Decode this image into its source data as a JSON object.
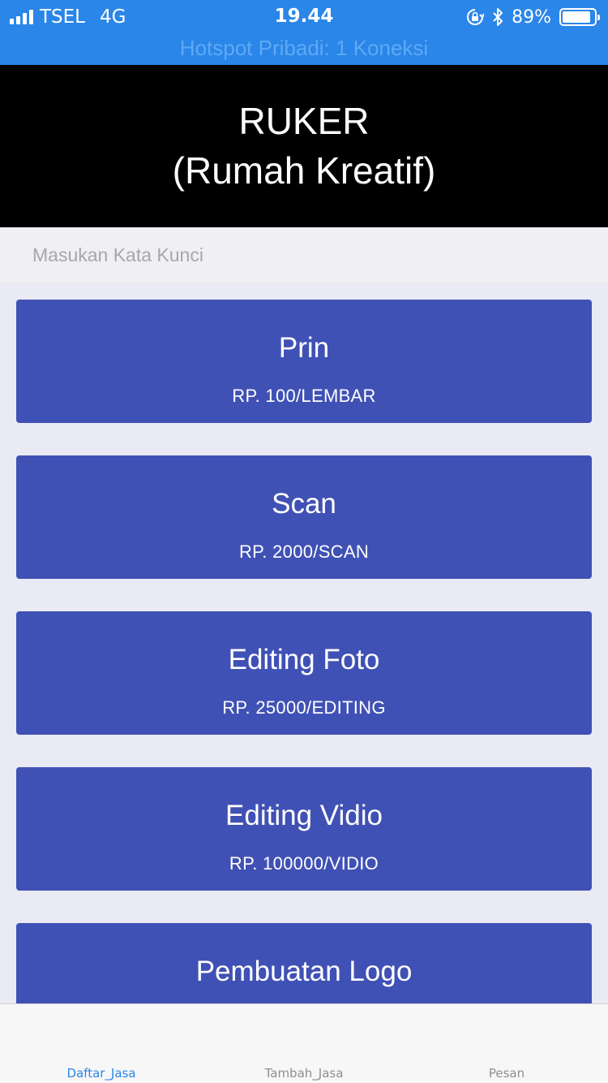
{
  "status_bar": {
    "carrier": "TSEL",
    "network": "4G",
    "time": "19.44",
    "battery_percent": "89%",
    "battery_level": 0.89,
    "hotspot": "Hotspot Pribadi: 1 Koneksi",
    "background_color": "#2a86e8",
    "icons": [
      "signal-bars-icon",
      "orientation-lock-icon",
      "bluetooth-icon",
      "battery-icon"
    ]
  },
  "header": {
    "title_line1": "RUKER",
    "title_line2": "(Rumah Kreatif)"
  },
  "search": {
    "placeholder": "Masukan Kata Kunci",
    "value": ""
  },
  "services": [
    {
      "name": "Prin",
      "price": "RP. 100/LEMBAR"
    },
    {
      "name": "Scan",
      "price": "RP. 2000/SCAN"
    },
    {
      "name": "Editing Foto",
      "price": "RP. 25000/EDITING"
    },
    {
      "name": "Editing Vidio",
      "price": "RP. 100000/VIDIO"
    },
    {
      "name": "Pembuatan Logo",
      "price": ""
    }
  ],
  "card_color": "#4051b5",
  "tabs": [
    {
      "label": "Daftar_Jasa",
      "active": true
    },
    {
      "label": "Tambah_Jasa",
      "active": false
    },
    {
      "label": "Pesan",
      "active": false
    }
  ],
  "accent_color": "#2a86e8"
}
